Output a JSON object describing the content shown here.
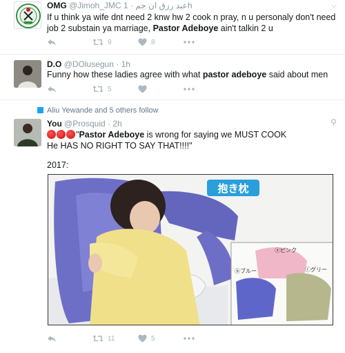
{
  "tweets": [
    {
      "name": "OMG",
      "handle": "@Jimoh_JMC",
      "arabic": "عبد رزق ان جم",
      "time": "1h",
      "dot": "·",
      "text_parts": [
        "If u think ya wife dnt need 2 knw hw 2 cook n pray, n u personaly don't need job 2 substain ya marriage, ",
        "Pastor Adeboye",
        " ain't talkin 2 u"
      ],
      "retweets": "9",
      "likes": "8"
    },
    {
      "name": "D.O",
      "handle": "@DOlusegun",
      "time": "1h",
      "dot": "·",
      "text_parts": [
        "Funny how these ladies agree with what ",
        "pastor adeboye",
        " said about men"
      ],
      "retweets": "5",
      "likes": ""
    },
    {
      "social_context": "Aliu Yewande and 5 others follow",
      "name": "You",
      "handle": "@Prosquid",
      "time": "2h",
      "dot": "·",
      "line1_parts": [
        "\"",
        "Pastor Adeboye",
        " is wrong for saying we MUST COOK"
      ],
      "line2": "He HAS NO RIGHT TO SAY THAT!!!!\"",
      "year_label": "2017:",
      "retweets": "11",
      "likes": "5",
      "image": {
        "jp_title": "抱き枕",
        "pink": "ⓐピンク",
        "blue": "ⓑブルー",
        "grey": "ⓒグリー"
      }
    }
  ],
  "icons": [
    "reply-icon",
    "retweet-icon",
    "like-icon",
    "more-icon",
    "chevron-down-icon",
    "follow-icon"
  ],
  "colors": {
    "icon": "#aab8c2",
    "muted": "#8899a6",
    "accent": "#1da1f2",
    "border": "#e6ecf0"
  }
}
